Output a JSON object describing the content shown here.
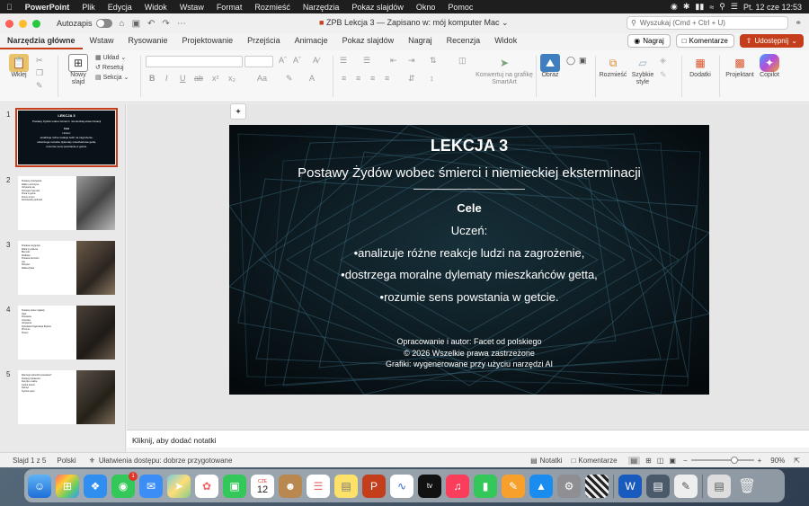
{
  "menubar": {
    "apple": "",
    "app_name": "PowerPoint",
    "items": [
      "Plik",
      "Edycja",
      "Widok",
      "Wstaw",
      "Format",
      "Rozmieść",
      "Narzędzia",
      "Pokaz slajdów",
      "Okno",
      "Pomoc"
    ],
    "clock": "Pt. 12 cze  12:53"
  },
  "titlebar": {
    "autosave_label": "Autozapis",
    "doc_title": "ZPB Lekcja 3 — Zapisano w: mój komputer Mac ⌄",
    "search_placeholder": "Wyszukaj (Cmd + Ctrl + U)"
  },
  "tabs": [
    "Narzędzia główne",
    "Wstaw",
    "Rysowanie",
    "Projektowanie",
    "Przejścia",
    "Animacje",
    "Pokaz slajdów",
    "Nagraj",
    "Recenzja",
    "Widok"
  ],
  "tab_buttons": {
    "record": "Nagraj",
    "comments": "Komentarze",
    "share": "Udostępnij"
  },
  "ribbon": {
    "paste": "Wklej",
    "new_slide": "Nowy slajd",
    "layout": "Układ",
    "reset": "Resetuj",
    "section": "Sekcja",
    "smartart": "Konwertuj na grafikę SmartArt",
    "picture": "Obraz",
    "arrange": "Rozmieść",
    "quick_styles": "Szybkie style",
    "addins": "Dodatki",
    "designer": "Projektant",
    "copilot": "Copilot"
  },
  "thumbnails": [
    {
      "num": "1",
      "title": "LEKCJA 3",
      "lines": [
        "Postawy Żydów wobec śmierci i niemieckiej eksterminacji",
        "Cele",
        "Uczeń:",
        "•analizuje różne reakcje ludzi na zagrożenie,",
        "•dostrzega moralne dylematy mieszkańców getta,",
        "•rozumie sens powstania w getcie."
      ]
    },
    {
      "num": "2",
      "lines": [
        "Postawy przetrwania",
        "Walka o przeżycie",
        "Ukrywanie się",
        "Szmugiel żywności",
        "Praca w getcie",
        "Pomoc innym",
        "Zachowanie godności"
      ]
    },
    {
      "num": "3",
      "lines": [
        "Postawa rezygnacji",
        "Wiara w ocalenie",
        "Bierność",
        "Modlitwa",
        "Postawa bierności",
        "Lęk",
        "Rozpacz",
        "Walka Żydów"
      ]
    },
    {
      "num": "4",
      "lines": [
        "Postawy wobec zagłady",
        "Opór",
        "Powstanie",
        "Ucieczka",
        "Ukrywanie",
        "Żydowska Organizacja Bojowa",
        "Przemoc",
        "Śmierć"
      ]
    },
    {
      "num": "5",
      "lines": [
        "Dlaczego wybuchło powstanie?",
        "Postawy bohaterów",
        "Decyzja o walce",
        "Godna śmierć",
        "Pamięć",
        "Symbol oporu"
      ]
    }
  ],
  "slide": {
    "title": "LEKCJA 3",
    "subtitle": "Postawy Żydów wobec śmierci i niemieckiej eksterminacji",
    "goals_heading": "Cele",
    "student": "Uczeń:",
    "goals": [
      "•analizuje różne reakcje ludzi na zagrożenie,",
      "•dostrzega moralne dylematy mieszkańców getta,",
      "•rozumie sens powstania w getcie."
    ],
    "credits": [
      "Opracowanie i autor: Facet od polskiego",
      "© 2026 Wszelkie prawa zastrzeżone",
      "Grafiki: wygenerowane przy użyciu narzędzi AI"
    ]
  },
  "notes_placeholder": "Kliknij, aby dodać notatki",
  "status": {
    "slide_count": "Slajd 1 z 5",
    "language": "Polski",
    "accessibility": "Ułatwienia dostępu: dobrze przygotowane",
    "notes": "Notatki",
    "comments": "Komentarze",
    "zoom": "90%"
  },
  "dock": {
    "calendar_month": "CZE",
    "calendar_day": "12",
    "messages_badge": "1",
    "appletv_label": "tv"
  }
}
